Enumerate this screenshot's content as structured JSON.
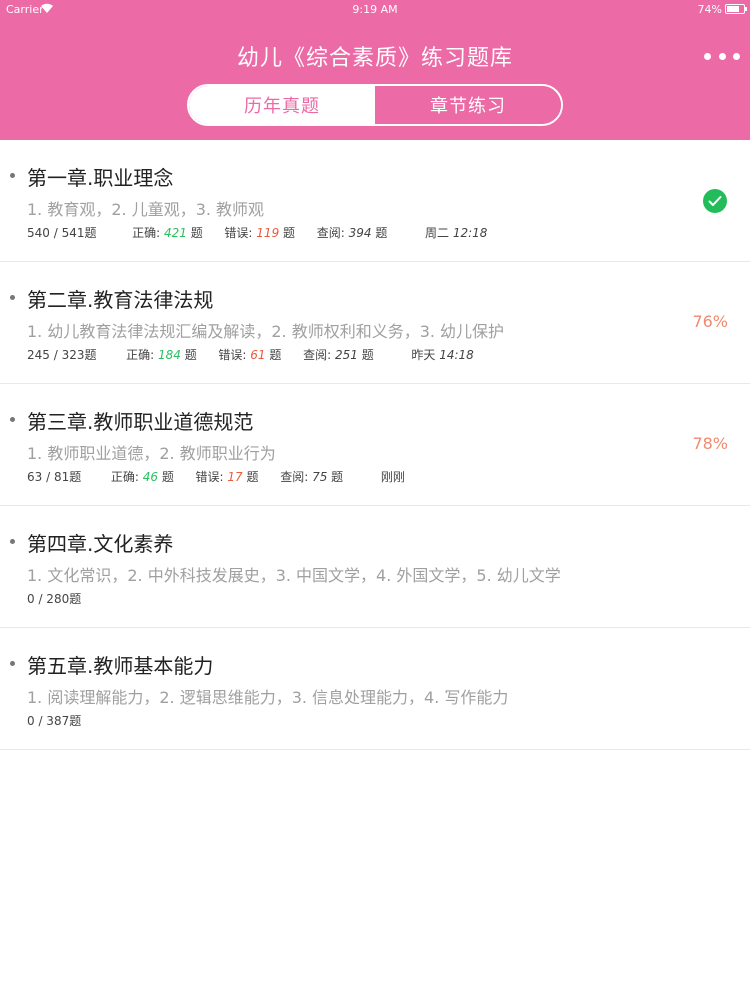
{
  "status_bar": {
    "carrier": "Carrier",
    "wifi_icon": "wifi-icon",
    "time": "9:19 AM",
    "battery_text": "74%",
    "battery_level": 0.74
  },
  "header": {
    "title": "幼儿《综合素质》练习题库",
    "more_icon": "more-dots-icon",
    "tabs": [
      {
        "label": "历年真题",
        "active": true
      },
      {
        "label": "章节练习",
        "active": false
      }
    ]
  },
  "colors": {
    "brand": "#ec6aa6",
    "correct": "#2bbf62",
    "error": "#ea5a3d",
    "percent": "#f08a70",
    "check": "#22bd5a"
  },
  "chapters": [
    {
      "title": "第一章.职业理念",
      "subtitle": "1. 教育观，2. 儿童观，3. 教师观",
      "progress": "540 / 541题",
      "correct_label": "正确:",
      "correct": "421",
      "error_label": "错误:",
      "error": "119",
      "view_label": "查阅:",
      "view": "394",
      "unit": "题",
      "time_prefix": "周二",
      "time": "12:18",
      "status": "check-icon"
    },
    {
      "title": "第二章.教育法律法规",
      "subtitle": "1. 幼儿教育法律法规汇编及解读，2. 教师权利和义务，3. 幼儿保护",
      "progress": "245 / 323题",
      "correct_label": "正确:",
      "correct": "184",
      "error_label": "错误:",
      "error": "61",
      "view_label": "查阅:",
      "view": "251",
      "unit": "题",
      "time_prefix": "昨天",
      "time": "14:18",
      "percent": "76%"
    },
    {
      "title": "第三章.教师职业道德规范",
      "subtitle": "1. 教师职业道德，2. 教师职业行为",
      "progress": "63 / 81题",
      "correct_label": "正确:",
      "correct": "46",
      "error_label": "错误:",
      "error": "17",
      "view_label": "查阅:",
      "view": "75",
      "unit": "题",
      "time_prefix": "刚刚",
      "time": "",
      "percent": "78%"
    },
    {
      "title": "第四章.文化素养",
      "subtitle": "1. 文化常识，2. 中外科技发展史，3. 中国文学，4. 外国文学，5. 幼儿文学",
      "progress": "0 / 280题"
    },
    {
      "title": "第五章.教师基本能力",
      "subtitle": "1. 阅读理解能力，2. 逻辑思维能力，3. 信息处理能力，4. 写作能力",
      "progress": "0 / 387题"
    }
  ]
}
